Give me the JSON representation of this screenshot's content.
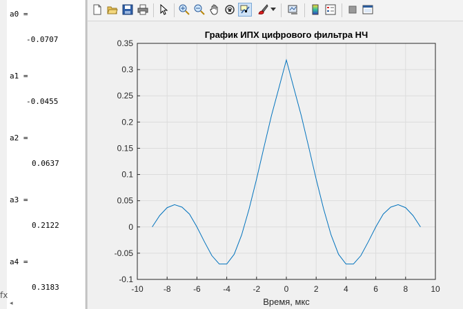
{
  "command_window": {
    "variables": [
      {
        "name": "a0 =",
        "value": "-0.0707"
      },
      {
        "name": "a1 =",
        "value": "-0.0455"
      },
      {
        "name": "a2 =",
        "value": "0.0637"
      },
      {
        "name": "a3 =",
        "value": "0.2122"
      },
      {
        "name": "a4 =",
        "value": "0.3183"
      }
    ],
    "bottom_marker": "fx",
    "bottom_arrow": "◂"
  },
  "toolbar": {
    "buttons": [
      {
        "name": "new-figure-icon",
        "active": false
      },
      {
        "name": "open-file-icon",
        "active": false
      },
      {
        "name": "save-icon",
        "active": false
      },
      {
        "name": "print-icon",
        "active": false
      },
      {
        "name": "select-arrow-icon",
        "active": false
      },
      {
        "name": "zoom-in-icon",
        "active": false
      },
      {
        "name": "zoom-out-icon",
        "active": false
      },
      {
        "name": "pan-hand-icon",
        "active": false
      },
      {
        "name": "rotate-3d-icon",
        "active": false
      },
      {
        "name": "data-cursor-icon",
        "active": true
      },
      {
        "name": "brush-icon",
        "active": false
      },
      {
        "name": "brush-dropdown-icon",
        "active": false
      },
      {
        "name": "link-plot-icon",
        "active": false
      },
      {
        "name": "colorbar-icon",
        "active": false
      },
      {
        "name": "legend-icon",
        "active": false
      },
      {
        "name": "hide-plot-tools-icon",
        "active": false
      },
      {
        "name": "show-plot-tools-icon",
        "active": false
      }
    ]
  },
  "chart_data": {
    "type": "line",
    "title": "График ИПХ цифрового фильтра НЧ",
    "xlabel": "Время, мкс",
    "ylabel": "",
    "xlim": [
      -10,
      10
    ],
    "ylim": [
      -0.1,
      0.35
    ],
    "x_ticks": [
      "-10",
      "-8",
      "-6",
      "-4",
      "-2",
      "0",
      "2",
      "4",
      "6",
      "8",
      "10"
    ],
    "y_ticks": [
      "-0.1",
      "-0.05",
      "0",
      "0.05",
      "0.1",
      "0.15",
      "0.2",
      "0.25",
      "0.3",
      "0.35"
    ],
    "grid": true,
    "line_color": "#0072BD",
    "series": [
      {
        "x": [
          -9,
          -8.5,
          -8,
          -7.5,
          -7,
          -6.5,
          -6,
          -5.5,
          -5,
          -4.5,
          -4,
          -3.5,
          -3,
          -2.5,
          -2,
          -1.5,
          -1,
          -0.5,
          0,
          0.5,
          1,
          1.5,
          2,
          2.5,
          3,
          3.5,
          4,
          4.5,
          5,
          5.5,
          6,
          6.5,
          7,
          7.5,
          8,
          8.5,
          9
        ],
        "y": [
          0,
          0.0217,
          0.0368,
          0.0424,
          0.0378,
          0.0245,
          0,
          -0.0281,
          -0.0546,
          -0.0707,
          -0.0707,
          -0.0521,
          -0.0152,
          0.0343,
          0.0912,
          0.1523,
          0.2122,
          0.2651,
          0.3183,
          0.2651,
          0.2122,
          0.1523,
          0.0912,
          0.0343,
          -0.0152,
          -0.0521,
          -0.0707,
          -0.0707,
          -0.0546,
          -0.0281,
          0,
          0.0245,
          0.0378,
          0.0424,
          0.0368,
          0.0217,
          0
        ]
      }
    ]
  }
}
